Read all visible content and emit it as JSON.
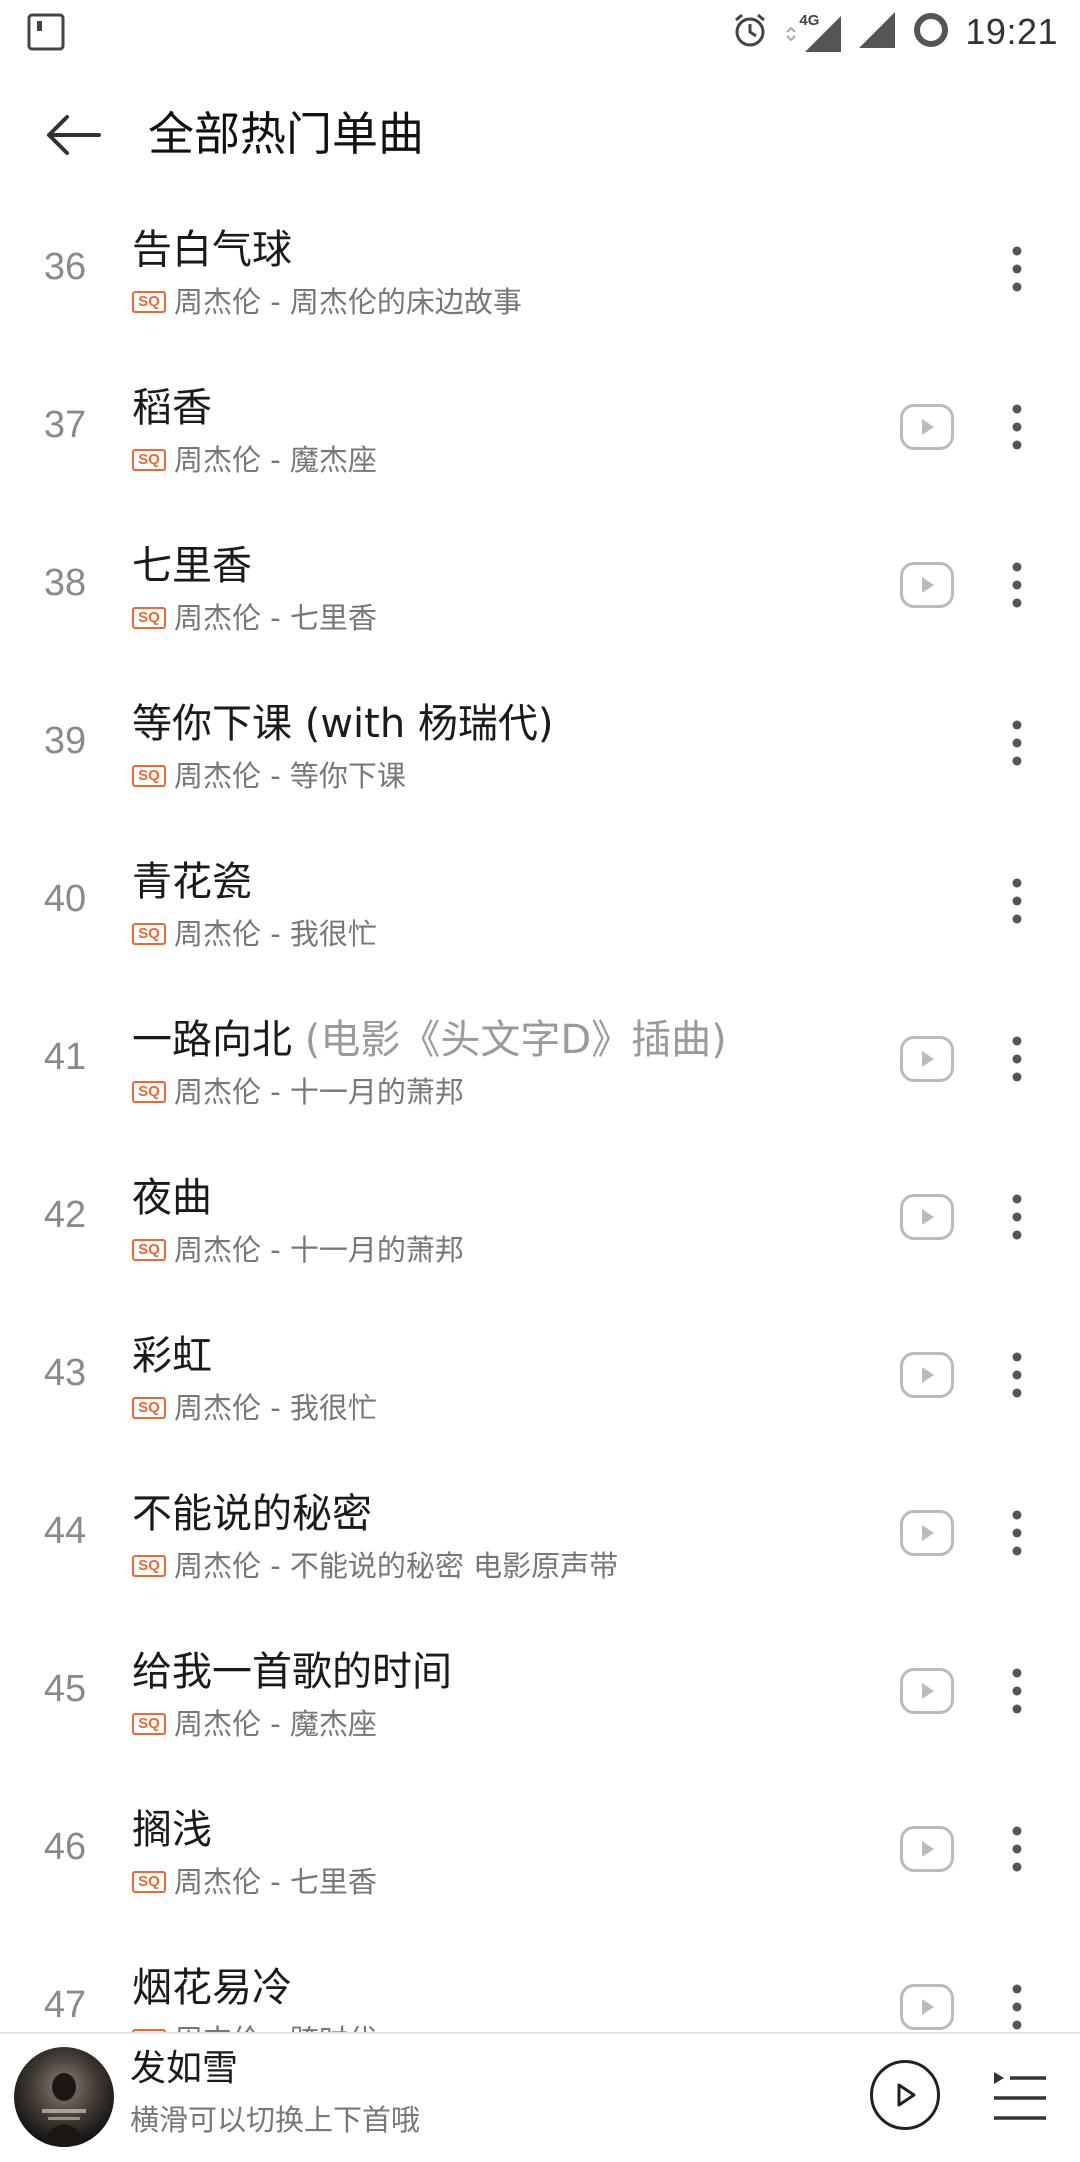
{
  "status_bar": {
    "time": "19:21",
    "network": "4G",
    "icons": [
      "sim-card-icon",
      "alarm-icon",
      "data-arrows-icon",
      "signal-icon",
      "signal-icon",
      "battery-ring-icon"
    ]
  },
  "header": {
    "title": "全部热门单曲",
    "back_icon": "arrow-left-icon"
  },
  "songs": [
    {
      "rank": "36",
      "title": "告白气球",
      "title_suffix": "",
      "meta": "周杰伦 - 周杰伦的床边故事",
      "badge": "SQ",
      "has_play": false
    },
    {
      "rank": "37",
      "title": "稻香",
      "title_suffix": "",
      "meta": "周杰伦 - 魔杰座",
      "badge": "SQ",
      "has_play": true
    },
    {
      "rank": "38",
      "title": "七里香",
      "title_suffix": "",
      "meta": "周杰伦 - 七里香",
      "badge": "SQ",
      "has_play": true
    },
    {
      "rank": "39",
      "title": "等你下课 (with 杨瑞代)",
      "title_suffix": "",
      "meta": "周杰伦 - 等你下课",
      "badge": "SQ",
      "has_play": false
    },
    {
      "rank": "40",
      "title": "青花瓷",
      "title_suffix": "",
      "meta": "周杰伦 - 我很忙",
      "badge": "SQ",
      "has_play": false
    },
    {
      "rank": "41",
      "title": "一路向北",
      "title_suffix": " (电影《头文字D》插曲)",
      "meta": "周杰伦 - 十一月的萧邦",
      "badge": "SQ",
      "has_play": true
    },
    {
      "rank": "42",
      "title": "夜曲",
      "title_suffix": "",
      "meta": "周杰伦 - 十一月的萧邦",
      "badge": "SQ",
      "has_play": true
    },
    {
      "rank": "43",
      "title": "彩虹",
      "title_suffix": "",
      "meta": "周杰伦 - 我很忙",
      "badge": "SQ",
      "has_play": true
    },
    {
      "rank": "44",
      "title": "不能说的秘密",
      "title_suffix": "",
      "meta": "周杰伦 - 不能说的秘密 电影原声带",
      "badge": "SQ",
      "has_play": true
    },
    {
      "rank": "45",
      "title": "给我一首歌的时间",
      "title_suffix": "",
      "meta": "周杰伦 - 魔杰座",
      "badge": "SQ",
      "has_play": true
    },
    {
      "rank": "46",
      "title": "搁浅",
      "title_suffix": "",
      "meta": "周杰伦 - 七里香",
      "badge": "SQ",
      "has_play": true
    },
    {
      "rank": "47",
      "title": "烟花易冷",
      "title_suffix": "",
      "meta": "周杰伦 - 跨时代",
      "badge": "SQ",
      "has_play": true
    }
  ],
  "player": {
    "song": "发如雪",
    "hint": "横滑可以切换上下首哦"
  },
  "colors": {
    "badge": "#ee6633",
    "rank": "#8a8a8a",
    "meta": "#777777",
    "title": "#1a1a1a"
  }
}
